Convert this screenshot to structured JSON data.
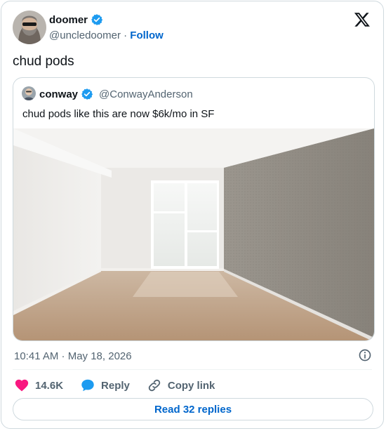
{
  "author": {
    "name": "doomer",
    "handle": "@uncledoomer",
    "separator": "·",
    "follow_label": "Follow"
  },
  "tweet": {
    "text": "chud pods",
    "timestamp": "10:41 AM · May 18, 2026"
  },
  "quote": {
    "name": "conway",
    "handle": "@ConwayAnderson",
    "text": "chud pods like this are now $6k/mo in SF"
  },
  "actions": {
    "likes": "14.6K",
    "reply_label": "Reply",
    "copy_label": "Copy link"
  },
  "footer": {
    "read_replies": "Read 32 replies"
  },
  "colors": {
    "link": "#0066cc",
    "verified": "#1d9bf0",
    "heart": "#f91880",
    "muted": "#536471"
  }
}
